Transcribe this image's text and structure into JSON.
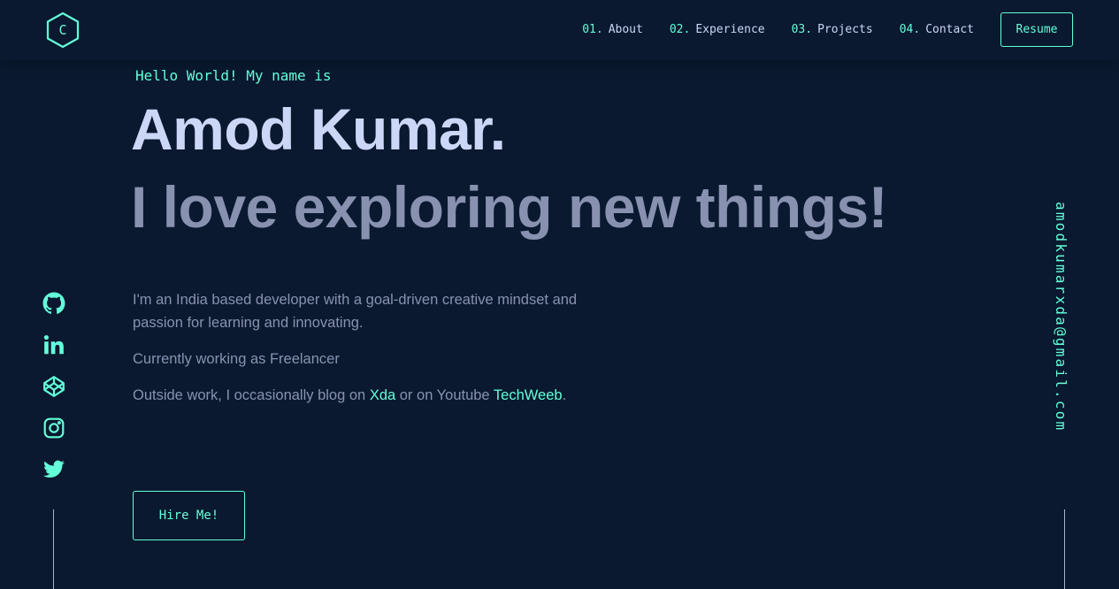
{
  "logo": {
    "letter": "C",
    "icon": "hexagon-logo-icon"
  },
  "nav": {
    "items": [
      {
        "num": "01.",
        "label": "About"
      },
      {
        "num": "02.",
        "label": "Experience"
      },
      {
        "num": "03.",
        "label": "Projects"
      },
      {
        "num": "04.",
        "label": "Contact"
      }
    ],
    "resume_label": "Resume"
  },
  "hero": {
    "greeting": "Hello World! My name is",
    "name": "Amod Kumar.",
    "tagline": "I love exploring new things!",
    "bio": {
      "line1": "I'm an India based developer with a goal-driven creative mindset and passion for learning and innovating.",
      "line2": "Currently working as Freelancer",
      "line3_prefix": "Outside work, I occasionally blog on ",
      "line3_link1": "Xda",
      "line3_middle": " or on Youtube ",
      "line3_link2": "TechWeeb",
      "line3_suffix": "."
    },
    "cta_label": "Hire Me!"
  },
  "social": {
    "icons": [
      "github-icon",
      "linkedin-icon",
      "codepen-icon",
      "instagram-icon",
      "twitter-icon"
    ]
  },
  "email": "amodkumarxda@gmail.com",
  "colors": {
    "background": "#0a192f",
    "accent": "#64ffda",
    "lightest_slate": "#ccd6f6",
    "slate": "#8892b0"
  }
}
